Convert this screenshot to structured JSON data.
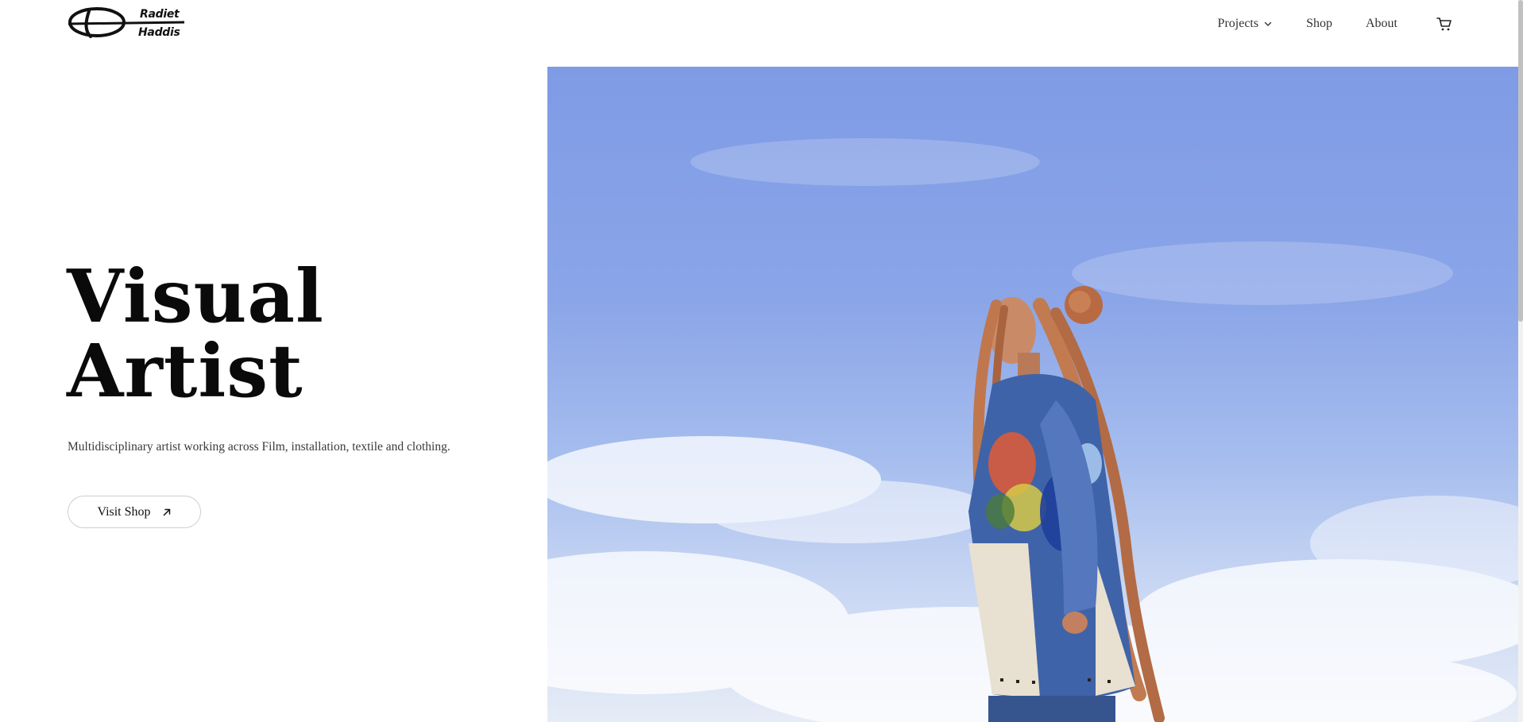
{
  "brand": {
    "first_name": "Radiet",
    "last_name": "Haddis",
    "logo_icon": "signature-logo"
  },
  "nav": {
    "projects_label": "Projects",
    "shop_label": "Shop",
    "about_label": "About",
    "projects_icon": "chevron-down-icon",
    "cart_icon": "cart-icon"
  },
  "hero": {
    "title_line1": "Visual",
    "title_line2": "Artist",
    "subtitle": "Multidisciplinary artist working across Film, installation, textile and clothing.",
    "cta_label": "Visit Shop",
    "cta_icon": "arrow-up-right-icon",
    "image_subject": "woman with long braids in painted denim jacket against blue sky"
  },
  "colors": {
    "text": "#111111",
    "subtle_text": "#3a3a3a",
    "button_border": "#cfcfcf",
    "sky_top": "#7f9be5",
    "sky_bottom": "#e6ecf7"
  }
}
